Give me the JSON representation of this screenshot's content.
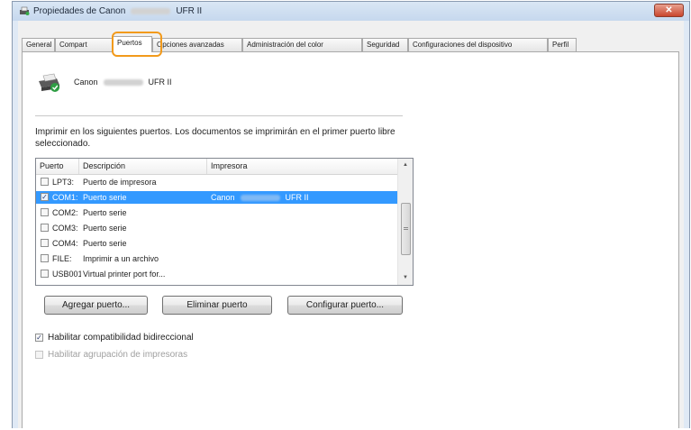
{
  "window": {
    "title_prefix": "Propiedades de Canon",
    "title_suffix": "UFR II",
    "close_glyph": "✕"
  },
  "tabs": [
    {
      "label": "General"
    },
    {
      "label": "Compart"
    },
    {
      "label": "Puertos"
    },
    {
      "label": "Opciones avanzadas"
    },
    {
      "label": "Administración del color"
    },
    {
      "label": "Seguridad"
    },
    {
      "label": "Configuraciones del dispositivo"
    },
    {
      "label": "Perfil"
    }
  ],
  "printer": {
    "name_prefix": "Canon",
    "name_suffix": "UFR II",
    "icon": "printer-icon"
  },
  "description": "Imprimir en los siguientes puertos. Los documentos se imprimirán en el primer puerto libre seleccionado.",
  "ports": {
    "columns": {
      "port": "Puerto",
      "description": "Descripción",
      "printer": "Impresora"
    },
    "rows": [
      {
        "port": "LPT3:",
        "description": "Puerto de impresora",
        "printer_prefix": "",
        "printer_suffix": "",
        "checked": false,
        "selected": false
      },
      {
        "port": "COM1:",
        "description": "Puerto serie",
        "printer_prefix": "Canon",
        "printer_suffix": "UFR II",
        "checked": true,
        "selected": true
      },
      {
        "port": "COM2:",
        "description": "Puerto serie",
        "printer_prefix": "",
        "printer_suffix": "",
        "checked": false,
        "selected": false
      },
      {
        "port": "COM3:",
        "description": "Puerto serie",
        "printer_prefix": "",
        "printer_suffix": "",
        "checked": false,
        "selected": false
      },
      {
        "port": "COM4:",
        "description": "Puerto serie",
        "printer_prefix": "",
        "printer_suffix": "",
        "checked": false,
        "selected": false
      },
      {
        "port": "FILE:",
        "description": "Imprimir a un archivo",
        "printer_prefix": "",
        "printer_suffix": "",
        "checked": false,
        "selected": false
      },
      {
        "port": "USB001",
        "description": "Virtual printer port for...",
        "printer_prefix": "",
        "printer_suffix": "",
        "checked": false,
        "selected": false
      }
    ]
  },
  "buttons": {
    "add_port": "Agregar puerto...",
    "delete_port": "Eliminar puerto",
    "configure_port": "Configurar puerto..."
  },
  "options": {
    "bidirectional": {
      "label": "Habilitar compatibilidad bidireccional",
      "checked": true,
      "enabled": true
    },
    "pooling": {
      "label": "Habilitar agrupación de impresoras",
      "checked": false,
      "enabled": false
    }
  },
  "colors": {
    "highlight": "#f29a1b",
    "selection": "#3399ff"
  }
}
